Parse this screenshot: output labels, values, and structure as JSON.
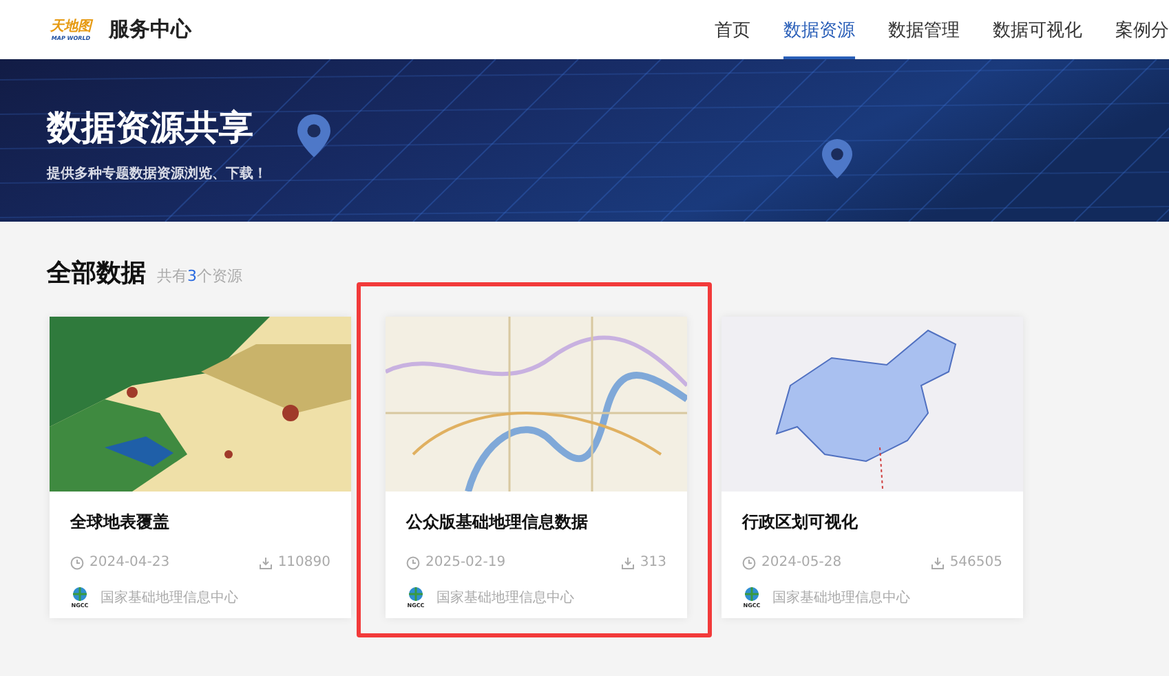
{
  "header": {
    "logo": {
      "name": "天地图",
      "tagline": "MAP WORLD"
    },
    "title": "服务中心",
    "nav": [
      {
        "label": "首页",
        "selected": false
      },
      {
        "label": "数据资源",
        "selected": true
      },
      {
        "label": "数据管理",
        "selected": false
      },
      {
        "label": "数据可视化",
        "selected": false
      },
      {
        "label": "案例分",
        "selected": false
      }
    ]
  },
  "banner": {
    "title": "数据资源共享",
    "subtitle": "提供多种专题数据资源浏览、下载！"
  },
  "section": {
    "title": "全部数据",
    "count_prefix": "共有",
    "count": "3",
    "count_suffix": "个资源"
  },
  "cards": [
    {
      "kind": "landcover",
      "title": "全球地表覆盖",
      "date": "2024-04-23",
      "downloads": "110890",
      "provider": "国家基础地理信息中心",
      "provider_logo_text": "NGCC",
      "highlighted": false
    },
    {
      "kind": "streetmap",
      "title": "公众版基础地理信息数据",
      "date": "2025-02-19",
      "downloads": "313",
      "provider": "国家基础地理信息中心",
      "provider_logo_text": "NGCC",
      "highlighted": true
    },
    {
      "kind": "countrymap",
      "title": "行政区划可视化",
      "date": "2024-05-28",
      "downloads": "546505",
      "provider": "国家基础地理信息中心",
      "provider_logo_text": "NGCC",
      "highlighted": false
    }
  ]
}
